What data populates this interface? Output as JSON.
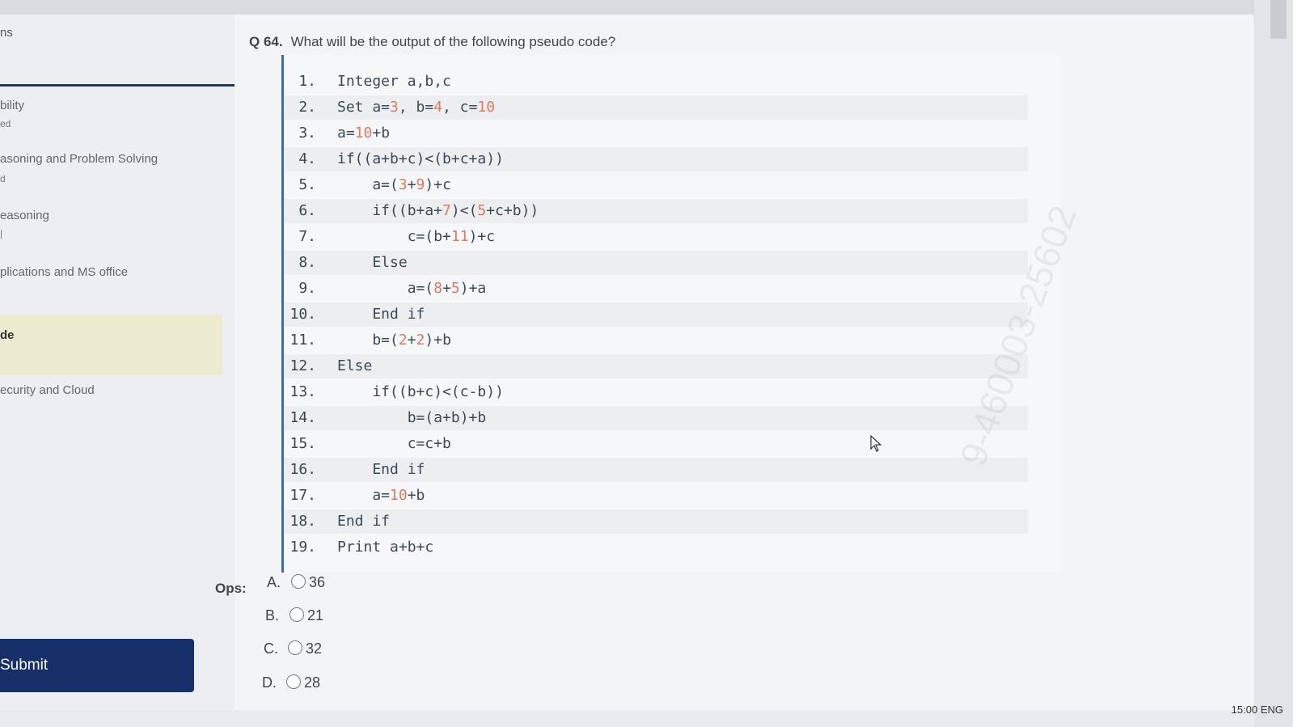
{
  "sidebar": {
    "header": "ns",
    "items": [
      {
        "label": "bility",
        "sub": "ed"
      },
      {
        "label": "asoning and Problem Solving",
        "sub": "d"
      },
      {
        "label": "easoning",
        "sub": "|"
      },
      {
        "label": "plications and MS office",
        "sub": ""
      },
      {
        "label": "de",
        "sub": ""
      },
      {
        "label": "ecurity and Cloud",
        "sub": ""
      }
    ],
    "submit_label": "Submit"
  },
  "question": {
    "number": "Q 64.",
    "text": "What will be the output of the following pseudo code?"
  },
  "code_lines": [
    {
      "n": "1.",
      "code": "Integer a,b,c"
    },
    {
      "n": "2.",
      "code": "Set a=3, b=4, c=10"
    },
    {
      "n": "3.",
      "code": "a=10+b"
    },
    {
      "n": "4.",
      "code": "if((a+b+c)<(b+c+a))"
    },
    {
      "n": "5.",
      "code": "    a=(3+9)+c"
    },
    {
      "n": "6.",
      "code": "    if((b+a+7)<(5+c+b))"
    },
    {
      "n": "7.",
      "code": "        c=(b+11)+c"
    },
    {
      "n": "8.",
      "code": "    Else"
    },
    {
      "n": "9.",
      "code": "        a=(8+5)+a"
    },
    {
      "n": "10.",
      "code": "    End if"
    },
    {
      "n": "11.",
      "code": "    b=(2+2)+b"
    },
    {
      "n": "12.",
      "code": "Else"
    },
    {
      "n": "13.",
      "code": "    if((b+c)<(c-b))"
    },
    {
      "n": "14.",
      "code": "        b=(a+b)+b"
    },
    {
      "n": "15.",
      "code": "        c=c+b"
    },
    {
      "n": "16.",
      "code": "    End if"
    },
    {
      "n": "17.",
      "code": "    a=10+b"
    },
    {
      "n": "18.",
      "code": "End if"
    },
    {
      "n": "19.",
      "code": "Print a+b+c"
    }
  ],
  "options": {
    "label": "Ops:",
    "items": [
      {
        "letter": "A.",
        "value": "36"
      },
      {
        "letter": "B.",
        "value": "21"
      },
      {
        "letter": "C.",
        "value": "32"
      },
      {
        "letter": "D.",
        "value": "28"
      }
    ]
  },
  "watermark": "9-460003-25602",
  "clock": "15:00  ENG"
}
